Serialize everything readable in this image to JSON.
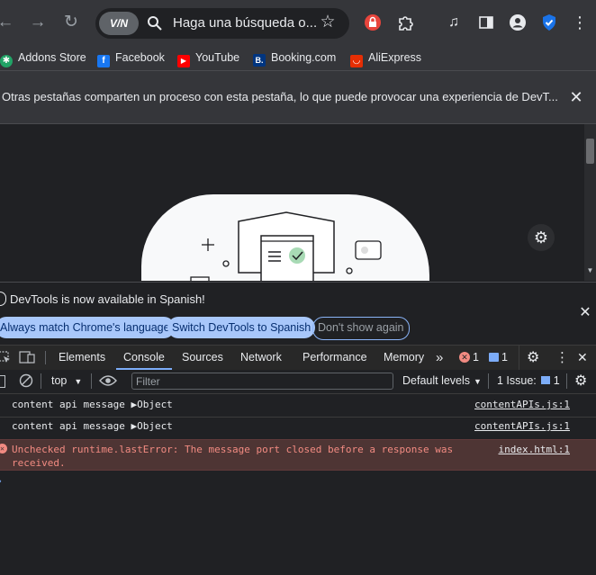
{
  "browser": {
    "omnibox": {
      "vpn_label": "V/N",
      "text": "Haga una búsqueda o..."
    },
    "icons": [
      "back-icon",
      "forward-icon",
      "reload-icon",
      "search-icon",
      "star-icon",
      "lock-extension-icon",
      "puzzle-icon",
      "media-icon",
      "side-panel-icon",
      "profile-icon",
      "shield-check-icon",
      "menu-icon"
    ]
  },
  "bookmarks": [
    {
      "label": "Addons Store",
      "color": "#21a366",
      "glyph": "✱"
    },
    {
      "label": "Facebook",
      "color": "#1877f2",
      "glyph": "f"
    },
    {
      "label": "YouTube",
      "color": "#ff0000",
      "glyph": "▶"
    },
    {
      "label": "Booking.com",
      "color": "#003580",
      "glyph": "B."
    },
    {
      "label": "AliExpress",
      "color": "#e62e04",
      "glyph": "◡"
    }
  ],
  "infobar": {
    "text": "Otras pestañas comparten un proceso con esta pestaña, lo que puede provocar una experiencia de DevT..."
  },
  "devtools_banner": {
    "message": "DevTools is now available in Spanish!",
    "btn_match": "Always match Chrome's language",
    "btn_switch": "Switch DevTools to Spanish",
    "btn_dont": "Don't show again"
  },
  "devtools_tabs": {
    "items": [
      "Elements",
      "Console",
      "Sources",
      "Network",
      "Performance",
      "Memory"
    ],
    "active": "Console",
    "error_count": "1",
    "message_count": "1"
  },
  "console_toolbar": {
    "context": "top",
    "filter_placeholder": "Filter",
    "levels": "Default levels",
    "issues_label": "1 Issue:",
    "issues_count": "1"
  },
  "console_rows": [
    {
      "type": "log",
      "message": "content api message ▶Object",
      "source": "contentAPIs.js:1"
    },
    {
      "type": "log",
      "message": "content api message ▶Object",
      "source": "contentAPIs.js:1"
    },
    {
      "type": "error",
      "message": "Unchecked runtime.lastError: The message port closed before a response was",
      "message2": "received.",
      "source": "index.html:1"
    }
  ],
  "colors": {
    "accent": "#7cacf8",
    "error": "#f28b82",
    "pill": "#a8c7fa"
  }
}
